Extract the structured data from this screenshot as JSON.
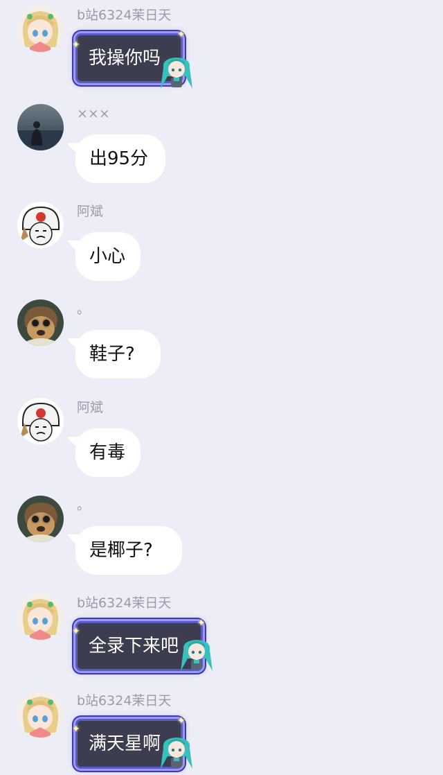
{
  "messages": [
    {
      "sender": "b站6324茉日天",
      "text": "我操你吗",
      "style": "fancy",
      "avatar": "anime-girl-avatar"
    },
    {
      "sender": "×××",
      "text": "出95分",
      "style": "plain",
      "avatar": "person-by-lake-avatar"
    },
    {
      "sender": "阿斌",
      "text": "小心",
      "style": "plain",
      "avatar": "helmet-meme-avatar"
    },
    {
      "sender": "。",
      "text": "鞋子?",
      "style": "plain",
      "avatar": "goggles-dog-avatar"
    },
    {
      "sender": "阿斌",
      "text": "有毒",
      "style": "plain",
      "avatar": "helmet-meme-avatar"
    },
    {
      "sender": "。",
      "text": "是椰子?",
      "style": "plain",
      "avatar": "goggles-dog-avatar"
    },
    {
      "sender": "b站6324茉日天",
      "text": "全录下来吧",
      "style": "fancy",
      "avatar": "anime-girl-avatar"
    },
    {
      "sender": "b站6324茉日天",
      "text": "满天星啊",
      "style": "fancy",
      "avatar": "anime-girl-avatar"
    }
  ],
  "colors": {
    "background": "#ededf7",
    "bubble": "#ffffff",
    "fancy_bubble": "#3c3d4f",
    "fancy_border": "#5b58c9",
    "name_text": "#9a9aa8"
  }
}
